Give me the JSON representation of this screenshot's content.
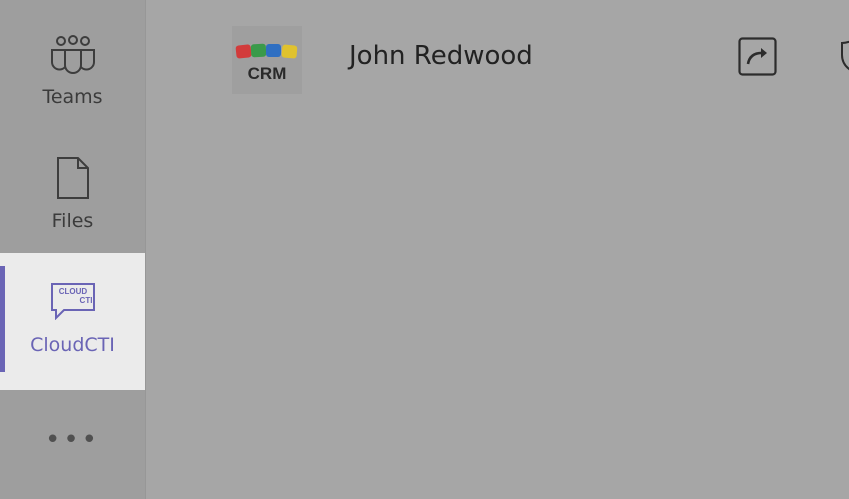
{
  "sidebar": {
    "items": [
      {
        "label": "Teams",
        "icon": "teams-icon"
      },
      {
        "label": "Files",
        "icon": "file-icon"
      },
      {
        "label": "CloudCTI",
        "icon": "cloudcti-icon",
        "icon_text_line1": "CLOUD",
        "icon_text_line2": "CTI",
        "active": true
      },
      {
        "label": "",
        "icon": "more-icon",
        "glyph": "•••"
      }
    ]
  },
  "header": {
    "logo_text": "CRM",
    "user_name": "John Redwood",
    "popout_icon": "popout-icon",
    "partial_icon": "shield-icon"
  },
  "colors": {
    "accent": "#6a64b5",
    "logo_red": "#d23b3b",
    "logo_green": "#3a9a4a",
    "logo_blue": "#2f6fc2",
    "logo_yellow": "#e0c22e"
  }
}
